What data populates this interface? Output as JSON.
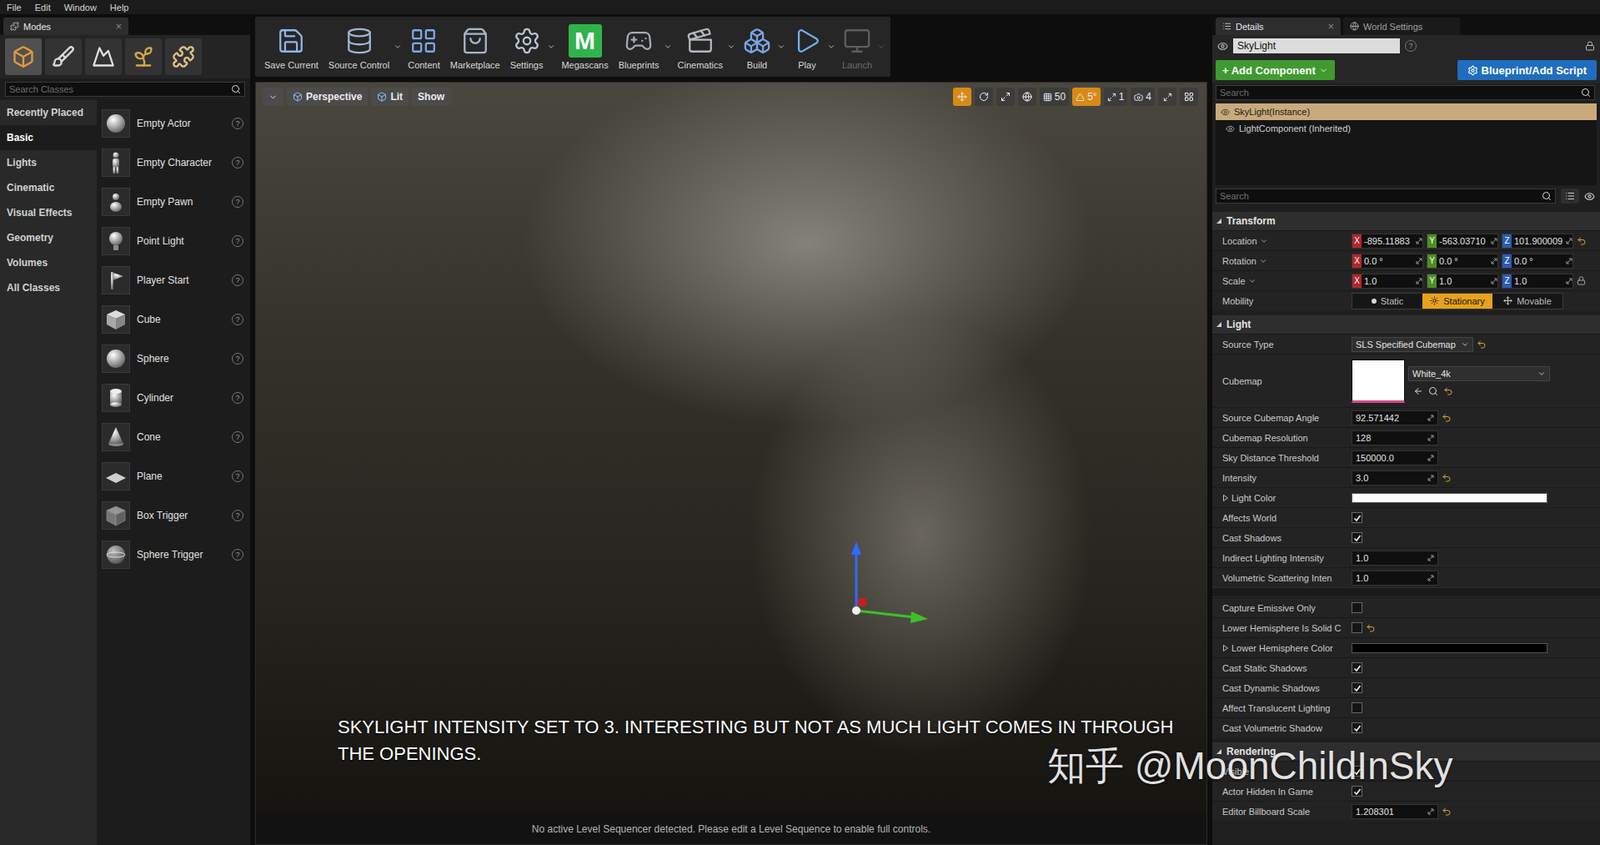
{
  "menu": [
    {
      "label": "File"
    },
    {
      "label": "Edit"
    },
    {
      "label": "Window"
    },
    {
      "label": "Help"
    }
  ],
  "modes_panel": {
    "tab": "Modes",
    "close": "×",
    "modes": [
      {
        "selected": true
      },
      {
        "selected": false
      },
      {
        "selected": false
      },
      {
        "selected": false
      },
      {
        "selected": false
      }
    ],
    "search": {
      "placeholder": "Search Classes"
    },
    "categories": [
      {
        "label": "Recently Placed",
        "selected": false
      },
      {
        "label": "Basic",
        "selected": true
      },
      {
        "label": "Lights",
        "selected": false
      },
      {
        "label": "Cinematic",
        "selected": false
      },
      {
        "label": "Visual Effects",
        "selected": false
      },
      {
        "label": "Geometry",
        "selected": false
      },
      {
        "label": "Volumes",
        "selected": false
      },
      {
        "label": "All Classes",
        "selected": false
      }
    ],
    "items": [
      {
        "label": "Empty Actor",
        "help": "?"
      },
      {
        "label": "Empty Character",
        "help": "?"
      },
      {
        "label": "Empty Pawn",
        "help": "?"
      },
      {
        "label": "Point Light",
        "help": "?"
      },
      {
        "label": "Player Start",
        "help": "?"
      },
      {
        "label": "Cube",
        "help": "?"
      },
      {
        "label": "Sphere",
        "help": "?"
      },
      {
        "label": "Cylinder",
        "help": "?"
      },
      {
        "label": "Cone",
        "help": "?"
      },
      {
        "label": "Plane",
        "help": "?"
      },
      {
        "label": "Box Trigger",
        "help": "?"
      },
      {
        "label": "Sphere Trigger",
        "help": "?"
      }
    ]
  },
  "toolbar": {
    "buttons": [
      {
        "label": "Save Current",
        "dropdown": false,
        "disabled": false
      },
      {
        "label": "Source Control",
        "dropdown": true,
        "disabled": false
      },
      {
        "label": "Content",
        "dropdown": false,
        "disabled": false
      },
      {
        "label": "Marketplace",
        "dropdown": false,
        "disabled": false
      },
      {
        "label": "Settings",
        "dropdown": true,
        "disabled": false
      },
      {
        "label": "Megascans",
        "dropdown": false,
        "disabled": false,
        "logo": "M"
      },
      {
        "label": "Blueprints",
        "dropdown": true,
        "disabled": false
      },
      {
        "label": "Cinematics",
        "dropdown": true,
        "disabled": false
      },
      {
        "label": "Build",
        "dropdown": true,
        "disabled": false
      },
      {
        "label": "Play",
        "dropdown": true,
        "disabled": false
      },
      {
        "label": "Launch",
        "dropdown": true,
        "disabled": true
      }
    ]
  },
  "viewport": {
    "view_buttons": [
      {
        "label": "Perspective"
      },
      {
        "label": "Lit"
      },
      {
        "label": "Show"
      }
    ],
    "transform_tools": [
      {
        "selected": true
      },
      {
        "selected": false
      },
      {
        "selected": false
      }
    ],
    "snaps": [
      {
        "label": "50",
        "active": false
      },
      {
        "label": "5°",
        "active": true
      },
      {
        "label": "1",
        "active": false
      },
      {
        "label": "4",
        "active": false
      }
    ],
    "caption": "SKYLIGHT INTENSITY SET TO 3. INTERESTING BUT NOT AS MUCH LIGHT COMES IN THROUGH THE OPENINGS.",
    "status": "No active Level Sequencer detected. Please edit a Level Sequence to enable full controls."
  },
  "details": {
    "tabs": [
      {
        "label": "Details",
        "selected": true,
        "closable": true
      },
      {
        "label": "World Settings",
        "selected": false,
        "closable": false
      }
    ],
    "close": "×",
    "name": "SkyLight",
    "help": "?",
    "add_component": "+ Add Component",
    "blueprint": "Blueprint/Add Script",
    "search_placeholder": "Search",
    "tree": [
      {
        "label": "SkyLight(Instance)",
        "selected": true
      },
      {
        "label": "LightComponent (Inherited)",
        "selected": false
      }
    ],
    "sections": [
      {
        "title": "Transform",
        "expanded": true,
        "rows": [
          {
            "kind": "vector",
            "label": "Location",
            "dropdown": true,
            "reset": true,
            "lock": false,
            "values": [
              {
                "axis": "X",
                "value": "-895.11883",
                "color": "#b3262b"
              },
              {
                "axis": "Y",
                "value": "-563.03710",
                "color": "#4c8f1f"
              },
              {
                "axis": "Z",
                "value": "101.900009",
                "color": "#2a5cb5"
              }
            ]
          },
          {
            "kind": "vector",
            "label": "Rotation",
            "dropdown": true,
            "reset": false,
            "lock": false,
            "values": [
              {
                "axis": "X",
                "value": "0.0 °",
                "color": "#b3262b"
              },
              {
                "axis": "Y",
                "value": "0.0 °",
                "color": "#4c8f1f"
              },
              {
                "axis": "Z",
                "value": "0.0 °",
                "color": "#2a5cb5"
              }
            ]
          },
          {
            "kind": "vector",
            "label": "Scale",
            "dropdown": true,
            "reset": false,
            "lock": true,
            "values": [
              {
                "axis": "X",
                "value": "1.0",
                "color": "#b3262b"
              },
              {
                "axis": "Y",
                "value": "1.0",
                "color": "#4c8f1f"
              },
              {
                "axis": "Z",
                "value": "1.0",
                "color": "#2a5cb5"
              }
            ]
          },
          {
            "kind": "mobility",
            "label": "Mobility",
            "options": [
              {
                "label": "Static",
                "selected": false
              },
              {
                "label": "Stationary",
                "selected": true
              },
              {
                "label": "Movable",
                "selected": false
              }
            ]
          }
        ],
        "advanced_rows": []
      },
      {
        "title": "Light",
        "expanded": true,
        "rows": [
          {
            "kind": "dropdown",
            "label": "Source Type",
            "value": "SLS Specified Cubemap",
            "reset": true
          },
          {
            "kind": "cubemap",
            "label": "Cubemap",
            "value": "White_4k",
            "reset": true
          },
          {
            "kind": "number",
            "label": "Source Cubemap Angle",
            "value": "92.571442",
            "reset": true
          },
          {
            "kind": "number",
            "label": "Cubemap Resolution",
            "value": "128",
            "reset": false
          },
          {
            "kind": "number",
            "label": "Sky Distance Threshold",
            "value": "150000.0",
            "reset": false
          },
          {
            "kind": "number",
            "label": "Intensity",
            "value": "3.0",
            "reset": true
          },
          {
            "kind": "color",
            "label": "Light Color",
            "color": "#ffffff",
            "expanded": false
          },
          {
            "kind": "checkbox",
            "label": "Affects World",
            "checked": true,
            "reset": false
          },
          {
            "kind": "checkbox",
            "label": "Cast Shadows",
            "checked": true,
            "reset": false
          },
          {
            "kind": "number",
            "label": "Indirect Lighting Intensity",
            "value": "1.0",
            "reset": false
          },
          {
            "kind": "number",
            "label": "Volumetric Scattering Inten",
            "value": "1.0",
            "reset": false
          }
        ],
        "advanced_rows": [
          {
            "kind": "checkbox",
            "label": "Capture Emissive Only",
            "checked": false,
            "reset": false
          },
          {
            "kind": "checkbox",
            "label": "Lower Hemisphere Is Solid C",
            "checked": false,
            "reset": true
          },
          {
            "kind": "color",
            "label": "Lower Hemisphere Color",
            "color": "#000000",
            "expanded": false
          },
          {
            "kind": "checkbox",
            "label": "Cast Static Shadows",
            "checked": true,
            "reset": false
          },
          {
            "kind": "checkbox",
            "label": "Cast Dynamic Shadows",
            "checked": true,
            "reset": false
          },
          {
            "kind": "checkbox",
            "label": "Affect Translucent Lighting",
            "checked": false,
            "reset": false
          },
          {
            "kind": "checkbox",
            "label": "Cast Volumetric Shadow",
            "checked": true,
            "reset": false
          }
        ]
      },
      {
        "title": "Rendering",
        "expanded": true,
        "rows": [
          {
            "kind": "checkbox",
            "label": "Visible",
            "checked": true,
            "reset": false
          },
          {
            "kind": "checkbox",
            "label": "Actor Hidden In Game",
            "checked": true,
            "reset": false
          },
          {
            "kind": "number",
            "label": "Editor Billboard Scale",
            "value": "1.208301",
            "reset": true
          }
        ],
        "advanced_rows": []
      }
    ]
  },
  "watermark": "知乎 @MoonChildInSky"
}
